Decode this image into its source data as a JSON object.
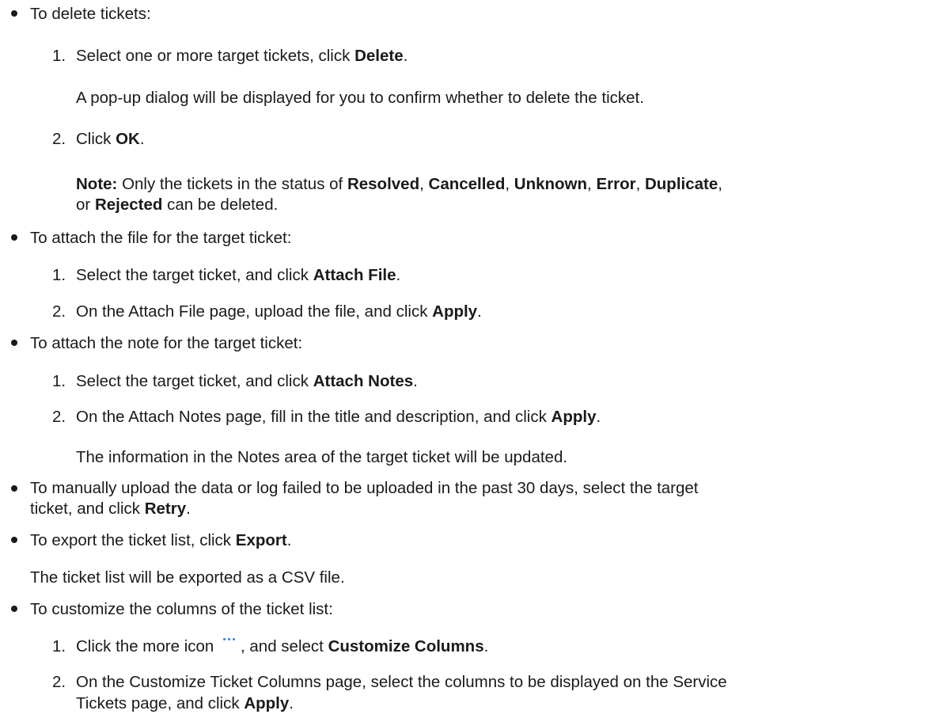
{
  "delete": {
    "intro": "To delete tickets:",
    "step1_pre": "Select one or more target tickets, click ",
    "step1_bold": "Delete",
    "step1_post": ".",
    "step1_note": "A pop-up dialog will be displayed for you to confirm whether to delete the ticket.",
    "step2_pre": "Click ",
    "step2_bold": "OK",
    "step2_post": ".",
    "note_label": "Note:",
    "note_pre": " Only the tickets in the status of ",
    "s1": "Resolved",
    "c1": ", ",
    "s2": "Cancelled",
    "c2": ", ",
    "s3": "Unknown",
    "c3": ", ",
    "s4": "Error",
    "c4": ", ",
    "s5": "Duplicate",
    "c5": ",",
    "note_or": "or ",
    "s6": "Rejected",
    "note_post": " can be deleted."
  },
  "attach_file": {
    "intro": "To attach the file for the target ticket:",
    "step1_pre": "Select the target ticket, and click ",
    "step1_bold": "Attach File",
    "step1_post": ".",
    "step2_pre": "On the Attach File page, upload the file, and click ",
    "step2_bold": "Apply",
    "step2_post": "."
  },
  "attach_note": {
    "intro": "To attach the note for the target ticket:",
    "step1_pre": "Select the target ticket, and click ",
    "step1_bold": "Attach Notes",
    "step1_post": ".",
    "step2_pre": "On the Attach Notes page, fill in the title and description, and click ",
    "step2_bold": "Apply",
    "step2_post": ".",
    "step2_note": "The information in the Notes area of the target ticket will be updated."
  },
  "retry": {
    "line1": "To manually upload the data or log failed to be uploaded in the past 30 days, select the target",
    "line2_pre": "ticket, and click ",
    "line2_bold": "Retry",
    "line2_post": "."
  },
  "export": {
    "pre": "To export the ticket list, click ",
    "bold": "Export",
    "post": ".",
    "note": "The ticket list will be exported as a CSV file."
  },
  "customize": {
    "intro": "To customize the columns of the ticket list:",
    "step1_pre": "Click the more icon ",
    "step1_mid": ", and select ",
    "step1_bold": "Customize Columns",
    "step1_post": ".",
    "step2_line1": "On the Customize Ticket Columns page, select the columns to be displayed on the Service",
    "step2_line2_pre": "Tickets page, and click ",
    "step2_line2_bold": "Apply",
    "step2_line2_post": "."
  },
  "numbers": {
    "n1": "1.",
    "n2": "2."
  },
  "colors": {
    "text": "#1a1a1a",
    "icon_accent": "#2f7fd6"
  },
  "icons": {
    "more": "more-icon"
  }
}
